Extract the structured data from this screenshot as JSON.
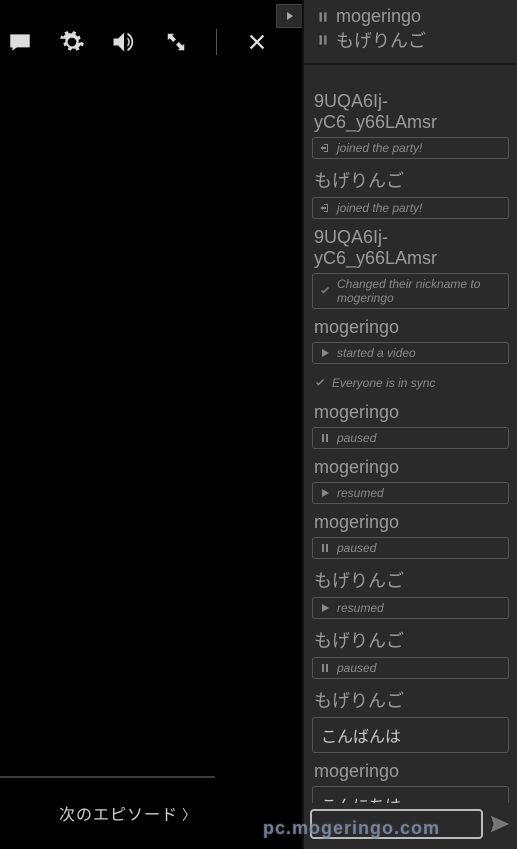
{
  "toolbar": {
    "icons": [
      "subtitles-icon",
      "gear-icon",
      "volume-icon",
      "fullscreen-icon",
      "close-icon"
    ]
  },
  "next_episode_label": "次のエピソード",
  "members": [
    {
      "status": "paused",
      "name": "mogeringo"
    },
    {
      "status": "paused",
      "name": "もげりんご"
    }
  ],
  "feed": [
    {
      "kind": "nick",
      "text": "9UQA6Ij-yC6_y66LAmsr"
    },
    {
      "kind": "status",
      "icon": "login",
      "text": "joined the party!"
    },
    {
      "kind": "nick",
      "text": "もげりんご"
    },
    {
      "kind": "status",
      "icon": "login",
      "text": "joined the party!"
    },
    {
      "kind": "nick",
      "text": "9UQA6Ij-yC6_y66LAmsr"
    },
    {
      "kind": "status",
      "icon": "check",
      "text": "Changed their nickname to mogeringo"
    },
    {
      "kind": "nick",
      "text": "mogeringo"
    },
    {
      "kind": "status",
      "icon": "play",
      "text": "started a video"
    },
    {
      "kind": "sync",
      "icon": "check",
      "text": "Everyone is in sync"
    },
    {
      "kind": "nick",
      "text": "mogeringo"
    },
    {
      "kind": "status",
      "icon": "pause",
      "text": "paused"
    },
    {
      "kind": "nick",
      "text": "mogeringo"
    },
    {
      "kind": "status",
      "icon": "play",
      "text": "resumed"
    },
    {
      "kind": "nick",
      "text": "mogeringo"
    },
    {
      "kind": "status",
      "icon": "pause",
      "text": "paused"
    },
    {
      "kind": "nick",
      "text": "もげりんご"
    },
    {
      "kind": "status",
      "icon": "play",
      "text": "resumed"
    },
    {
      "kind": "nick",
      "text": "もげりんご"
    },
    {
      "kind": "status",
      "icon": "pause",
      "text": "paused"
    },
    {
      "kind": "nick",
      "text": "もげりんご"
    },
    {
      "kind": "msg",
      "text": "こんばんは"
    },
    {
      "kind": "nick",
      "text": "mogeringo"
    },
    {
      "kind": "msg",
      "text": "こんにちは"
    }
  ],
  "watermark": "pc.mogeringo.com"
}
